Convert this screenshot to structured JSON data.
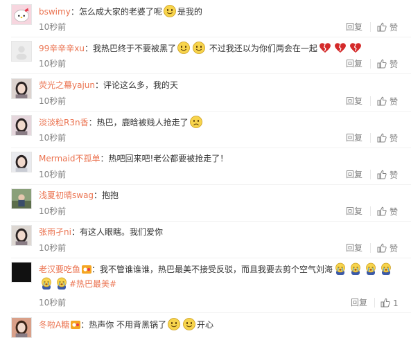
{
  "comments": [
    {
      "user": "bswimy",
      "segments": [
        {
          "t": "text",
          "v": "：怎么成大家的老婆了呢"
        },
        {
          "t": "emoji",
          "v": "smile-face"
        },
        {
          "t": "text",
          "v": "是我的"
        }
      ],
      "time": "10秒前",
      "reply": "回复",
      "like": "赞"
    },
    {
      "user": "99辛辛辛xu",
      "segments": [
        {
          "t": "text",
          "v": "：我热巴终于不要被黑了"
        },
        {
          "t": "emoji",
          "v": "smile-face"
        },
        {
          "t": "emoji",
          "v": "smile-face"
        },
        {
          "t": "text",
          "v": "    不过我还以为你们两会在一起"
        },
        {
          "t": "emoji",
          "v": "broken-heart"
        },
        {
          "t": "emoji",
          "v": "broken-heart"
        },
        {
          "t": "emoji",
          "v": "broken-heart"
        }
      ],
      "time": "10秒前",
      "reply": "回复",
      "like": "赞"
    },
    {
      "user": "荧光之幕yajun",
      "segments": [
        {
          "t": "text",
          "v": "：评论这么多，我的天"
        }
      ],
      "time": "10秒前",
      "reply": "回复",
      "like": "赞"
    },
    {
      "user": "淡淡粒R3n香",
      "segments": [
        {
          "t": "text",
          "v": "：热巴，鹿晗被贱人抢走了"
        },
        {
          "t": "emoji",
          "v": "sad-face"
        }
      ],
      "time": "10秒前",
      "reply": "回复",
      "like": "赞"
    },
    {
      "user": "Mermaid不孤单",
      "segments": [
        {
          "t": "text",
          "v": "：热吧回来吧!老公都要被抢走了！"
        }
      ],
      "time": "10秒前",
      "reply": "回复",
      "like": "赞"
    },
    {
      "user": "浅夏初晴swag",
      "segments": [
        {
          "t": "text",
          "v": "：抱抱"
        }
      ],
      "time": "10秒前",
      "reply": "回复",
      "like": "赞"
    },
    {
      "user": "张雨孑ni",
      "segments": [
        {
          "t": "text",
          "v": "：有这人眼瞎。我们爱你"
        }
      ],
      "time": "10秒前",
      "reply": "回复",
      "like": "赞"
    },
    {
      "user": "老汉要吃鱼",
      "segments": [
        {
          "t": "text",
          "v": "：我不管谁谁谁，热巴最美不接受反驳，而且我要去剪个空气刘海"
        },
        {
          "t": "emoji",
          "v": "crying-face"
        },
        {
          "t": "emoji",
          "v": "crying-face"
        },
        {
          "t": "emoji",
          "v": "crying-face"
        },
        {
          "t": "emoji",
          "v": "crying-face"
        },
        {
          "t": "emoji",
          "v": "crying-face"
        },
        {
          "t": "emoji",
          "v": "crying-face"
        },
        {
          "t": "hashtag",
          "v": "#热巴最美#"
        }
      ],
      "time": "10秒前",
      "reply": "回复",
      "like": "赞",
      "like_count": "1"
    },
    {
      "user": "冬啦A糖",
      "segments": [
        {
          "t": "text",
          "v": "：热声你 不用背黑锅了"
        },
        {
          "t": "emoji",
          "v": "smile-face"
        },
        {
          "t": "emoji",
          "v": "smile-face"
        },
        {
          "t": "text",
          "v": "开心"
        }
      ],
      "time": "",
      "reply": "",
      "like": ""
    }
  ],
  "colors": {
    "username": "#eb7350",
    "text": "#333333",
    "meta": "#808080",
    "divider": "#f2f2f2"
  }
}
